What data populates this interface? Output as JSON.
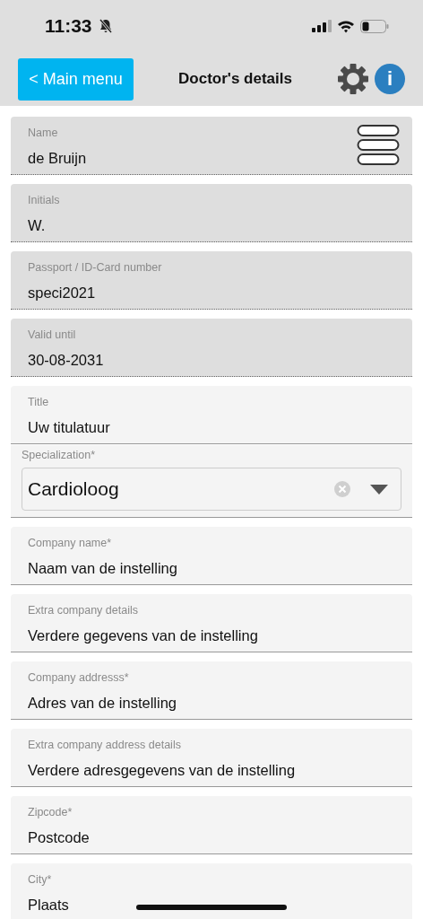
{
  "status_bar": {
    "time": "11:33",
    "silent": true
  },
  "header": {
    "back_button": "< Main menu",
    "title": "Doctor's details",
    "info_icon": "i"
  },
  "fields": [
    {
      "kind": "text",
      "label": "Name",
      "value": "de Bruijn",
      "locked": true,
      "menu": true
    },
    {
      "kind": "text",
      "label": "Initials",
      "value": "W.",
      "locked": true,
      "menu": false
    },
    {
      "kind": "text",
      "label": "Passport / ID-Card number",
      "value": "speci2021",
      "locked": true,
      "menu": false
    },
    {
      "kind": "text",
      "label": "Valid until",
      "value": "30-08-2031",
      "locked": true,
      "menu": false
    },
    {
      "kind": "text",
      "label": "Title",
      "value": "Uw titulatuur",
      "locked": false,
      "menu": false
    },
    {
      "kind": "select",
      "label": "Specialization*",
      "value": "Cardioloog",
      "locked": false
    },
    {
      "kind": "text",
      "label": "Company name*",
      "value": "Naam van de instelling",
      "locked": false,
      "menu": false
    },
    {
      "kind": "text",
      "label": "Extra company details",
      "value": "Verdere gegevens van de instelling",
      "locked": false,
      "menu": false
    },
    {
      "kind": "text",
      "label": "Company addresss*",
      "value": "Adres van de instelling",
      "locked": false,
      "menu": false
    },
    {
      "kind": "text",
      "label": "Extra company address details",
      "value": "Verdere adresgegevens van de instelling",
      "locked": false,
      "menu": false
    },
    {
      "kind": "text",
      "label": "Zipcode*",
      "value": "Postcode",
      "locked": false,
      "menu": false
    },
    {
      "kind": "text",
      "label": "City*",
      "value": "Plaats",
      "locked": false,
      "menu": false
    }
  ]
}
